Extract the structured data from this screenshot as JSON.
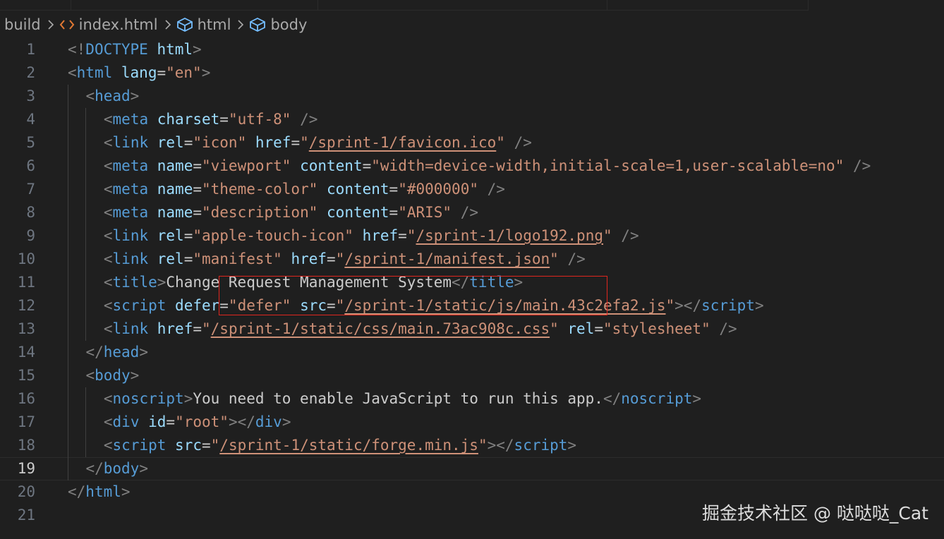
{
  "breadcrumb": {
    "items": [
      {
        "label": "build",
        "icon": ""
      },
      {
        "label": "index.html",
        "icon": "html-file-icon"
      },
      {
        "label": "html",
        "icon": "symbol-cube-icon"
      },
      {
        "label": "body",
        "icon": "symbol-cube-icon"
      }
    ]
  },
  "colors": {
    "background": "#1f1f1f",
    "line_number": "#6e7681",
    "tag": "#569cd6",
    "attribute": "#9cdcfe",
    "string": "#ce9178",
    "punctuation": "#808080",
    "text": "#cccccc",
    "highlight_box": "#e0261e"
  },
  "editor": {
    "current_line": 19,
    "lines": [
      {
        "n": "1",
        "indent": 0,
        "tokens": [
          [
            "t",
            "<!"
          ],
          [
            "tag",
            "DOCTYPE"
          ],
          [
            "t",
            " "
          ],
          [
            "at",
            "html"
          ],
          [
            "t",
            ">"
          ]
        ]
      },
      {
        "n": "2",
        "indent": 0,
        "tokens": [
          [
            "t",
            "<"
          ],
          [
            "tag",
            "html"
          ],
          [
            "t",
            " "
          ],
          [
            "at",
            "lang"
          ],
          [
            "p",
            "="
          ],
          [
            "s",
            "\"en\""
          ],
          [
            "t",
            ">"
          ]
        ]
      },
      {
        "n": "3",
        "indent": 1,
        "tokens": [
          [
            "t",
            "<"
          ],
          [
            "tag",
            "head"
          ],
          [
            "t",
            ">"
          ]
        ]
      },
      {
        "n": "4",
        "indent": 2,
        "tokens": [
          [
            "t",
            "<"
          ],
          [
            "tag",
            "meta"
          ],
          [
            "t",
            " "
          ],
          [
            "at",
            "charset"
          ],
          [
            "p",
            "="
          ],
          [
            "s",
            "\"utf-8\""
          ],
          [
            "t",
            " />"
          ]
        ]
      },
      {
        "n": "5",
        "indent": 2,
        "tokens": [
          [
            "t",
            "<"
          ],
          [
            "tag",
            "link"
          ],
          [
            "t",
            " "
          ],
          [
            "at",
            "rel"
          ],
          [
            "p",
            "="
          ],
          [
            "s",
            "\"icon\""
          ],
          [
            "t",
            " "
          ],
          [
            "at",
            "href"
          ],
          [
            "p",
            "="
          ],
          [
            "s",
            "\""
          ],
          [
            "su",
            "/sprint-1/favicon.ico"
          ],
          [
            "s",
            "\""
          ],
          [
            "t",
            " />"
          ]
        ]
      },
      {
        "n": "6",
        "indent": 2,
        "tokens": [
          [
            "t",
            "<"
          ],
          [
            "tag",
            "meta"
          ],
          [
            "t",
            " "
          ],
          [
            "at",
            "name"
          ],
          [
            "p",
            "="
          ],
          [
            "s",
            "\"viewport\""
          ],
          [
            "t",
            " "
          ],
          [
            "at",
            "content"
          ],
          [
            "p",
            "="
          ],
          [
            "s",
            "\"width=device-width,initial-scale=1,user-scalable=no\""
          ],
          [
            "t",
            " />"
          ]
        ]
      },
      {
        "n": "7",
        "indent": 2,
        "tokens": [
          [
            "t",
            "<"
          ],
          [
            "tag",
            "meta"
          ],
          [
            "t",
            " "
          ],
          [
            "at",
            "name"
          ],
          [
            "p",
            "="
          ],
          [
            "s",
            "\"theme-color\""
          ],
          [
            "t",
            " "
          ],
          [
            "at",
            "content"
          ],
          [
            "p",
            "="
          ],
          [
            "s",
            "\"#000000\""
          ],
          [
            "t",
            " />"
          ]
        ]
      },
      {
        "n": "8",
        "indent": 2,
        "tokens": [
          [
            "t",
            "<"
          ],
          [
            "tag",
            "meta"
          ],
          [
            "t",
            " "
          ],
          [
            "at",
            "name"
          ],
          [
            "p",
            "="
          ],
          [
            "s",
            "\"description\""
          ],
          [
            "t",
            " "
          ],
          [
            "at",
            "content"
          ],
          [
            "p",
            "="
          ],
          [
            "s",
            "\"ARIS\""
          ],
          [
            "t",
            " />"
          ]
        ]
      },
      {
        "n": "9",
        "indent": 2,
        "tokens": [
          [
            "t",
            "<"
          ],
          [
            "tag",
            "link"
          ],
          [
            "t",
            " "
          ],
          [
            "at",
            "rel"
          ],
          [
            "p",
            "="
          ],
          [
            "s",
            "\"apple-touch-icon\""
          ],
          [
            "t",
            " "
          ],
          [
            "at",
            "href"
          ],
          [
            "p",
            "="
          ],
          [
            "s",
            "\""
          ],
          [
            "su",
            "/sprint-1/logo192.png"
          ],
          [
            "s",
            "\""
          ],
          [
            "t",
            " />"
          ]
        ]
      },
      {
        "n": "10",
        "indent": 2,
        "tokens": [
          [
            "t",
            "<"
          ],
          [
            "tag",
            "link"
          ],
          [
            "t",
            " "
          ],
          [
            "at",
            "rel"
          ],
          [
            "p",
            "="
          ],
          [
            "s",
            "\"manifest\""
          ],
          [
            "t",
            " "
          ],
          [
            "at",
            "href"
          ],
          [
            "p",
            "="
          ],
          [
            "s",
            "\""
          ],
          [
            "su",
            "/sprint-1/manifest.json"
          ],
          [
            "s",
            "\""
          ],
          [
            "t",
            " />"
          ]
        ]
      },
      {
        "n": "11",
        "indent": 2,
        "tokens": [
          [
            "t",
            "<"
          ],
          [
            "tag",
            "title"
          ],
          [
            "t",
            ">"
          ],
          [
            "p",
            "Change Request Management System"
          ],
          [
            "t",
            "</"
          ],
          [
            "tag",
            "title"
          ],
          [
            "t",
            ">"
          ]
        ]
      },
      {
        "n": "12",
        "indent": 2,
        "tokens": [
          [
            "t",
            "<"
          ],
          [
            "tag",
            "script"
          ],
          [
            "t",
            " "
          ],
          [
            "at",
            "defer"
          ],
          [
            "p",
            "="
          ],
          [
            "s",
            "\"defer\""
          ],
          [
            "t",
            " "
          ],
          [
            "at",
            "src"
          ],
          [
            "p",
            "="
          ],
          [
            "s",
            "\""
          ],
          [
            "su",
            "/sprint-1/static/js/main.43c2efa2.js"
          ],
          [
            "s",
            "\""
          ],
          [
            "t",
            "></"
          ],
          [
            "tag",
            "script"
          ],
          [
            "t",
            ">"
          ]
        ]
      },
      {
        "n": "13",
        "indent": 2,
        "tokens": [
          [
            "t",
            "<"
          ],
          [
            "tag",
            "link"
          ],
          [
            "t",
            " "
          ],
          [
            "at",
            "href"
          ],
          [
            "p",
            "="
          ],
          [
            "s",
            "\""
          ],
          [
            "su",
            "/sprint-1/static/css/main.73ac908c.css"
          ],
          [
            "s",
            "\""
          ],
          [
            "t",
            " "
          ],
          [
            "at",
            "rel"
          ],
          [
            "p",
            "="
          ],
          [
            "s",
            "\"stylesheet\""
          ],
          [
            "t",
            " />"
          ]
        ]
      },
      {
        "n": "14",
        "indent": 1,
        "tokens": [
          [
            "t",
            "</"
          ],
          [
            "tag",
            "head"
          ],
          [
            "t",
            ">"
          ]
        ]
      },
      {
        "n": "15",
        "indent": 1,
        "tokens": [
          [
            "t",
            "<"
          ],
          [
            "tag",
            "body"
          ],
          [
            "t",
            ">"
          ]
        ]
      },
      {
        "n": "16",
        "indent": 2,
        "tokens": [
          [
            "t",
            "<"
          ],
          [
            "tag",
            "noscript"
          ],
          [
            "t",
            ">"
          ],
          [
            "p",
            "You need to enable JavaScript to run this app."
          ],
          [
            "t",
            "</"
          ],
          [
            "tag",
            "noscript"
          ],
          [
            "t",
            ">"
          ]
        ]
      },
      {
        "n": "17",
        "indent": 2,
        "tokens": [
          [
            "t",
            "<"
          ],
          [
            "tag",
            "div"
          ],
          [
            "t",
            " "
          ],
          [
            "at",
            "id"
          ],
          [
            "p",
            "="
          ],
          [
            "s",
            "\"root\""
          ],
          [
            "t",
            "></"
          ],
          [
            "tag",
            "div"
          ],
          [
            "t",
            ">"
          ]
        ]
      },
      {
        "n": "18",
        "indent": 2,
        "tokens": [
          [
            "t",
            "<"
          ],
          [
            "tag",
            "script"
          ],
          [
            "t",
            " "
          ],
          [
            "at",
            "src"
          ],
          [
            "p",
            "="
          ],
          [
            "s",
            "\""
          ],
          [
            "su",
            "/sprint-1/static/forge.min.js"
          ],
          [
            "s",
            "\""
          ],
          [
            "t",
            "></"
          ],
          [
            "tag",
            "script"
          ],
          [
            "t",
            ">"
          ]
        ]
      },
      {
        "n": "19",
        "indent": 1,
        "tokens": [
          [
            "t",
            "</"
          ],
          [
            "tag",
            "body"
          ],
          [
            "t",
            ">"
          ]
        ]
      },
      {
        "n": "20",
        "indent": 0,
        "tokens": [
          [
            "t",
            "</"
          ],
          [
            "tag",
            "html"
          ],
          [
            "t",
            ">"
          ]
        ]
      },
      {
        "n": "21",
        "indent": 0,
        "tokens": []
      }
    ]
  },
  "watermark": "掘金技术社区 @ 哒哒哒_Cat"
}
